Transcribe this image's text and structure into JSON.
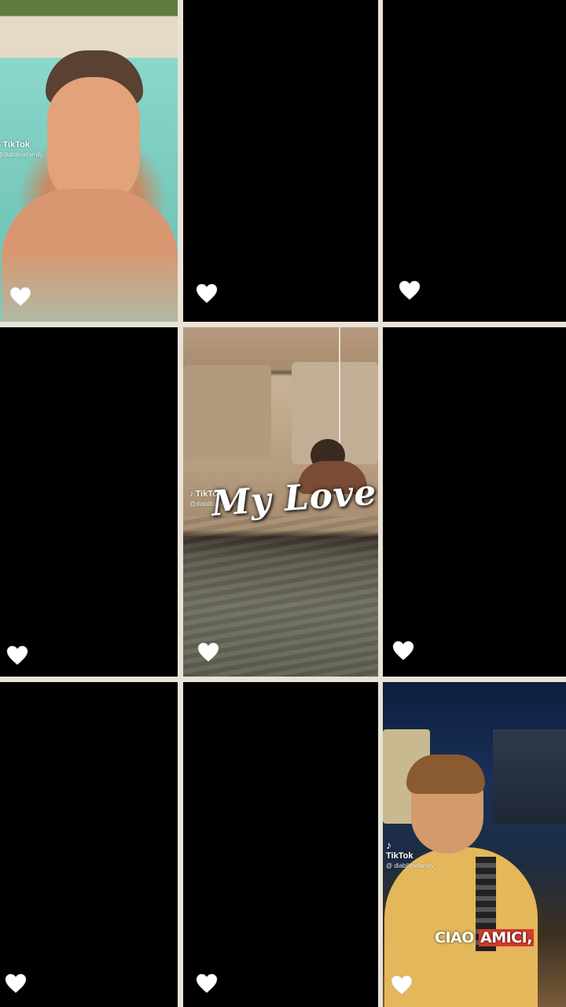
{
  "grid": {
    "tiles": [
      {
        "id": "tile-1",
        "type": "video",
        "watermark": {
          "brand": "TikTok",
          "handle": "@diablitoefamily"
        }
      },
      {
        "id": "tile-2",
        "type": "blank"
      },
      {
        "id": "tile-3",
        "type": "blank"
      },
      {
        "id": "tile-4",
        "type": "blank"
      },
      {
        "id": "tile-5",
        "type": "video",
        "overlay_text": "My Love",
        "watermark": {
          "brand": "TikTok",
          "handle": "@diablitoefamily"
        }
      },
      {
        "id": "tile-6",
        "type": "blank"
      },
      {
        "id": "tile-7",
        "type": "blank"
      },
      {
        "id": "tile-8",
        "type": "blank"
      },
      {
        "id": "tile-9",
        "type": "video",
        "caption_word1": "CIAO",
        "caption_word2": "AMICI,",
        "watermark": {
          "brand": "TikTok",
          "handle": "@ diablitoefamily"
        }
      }
    ],
    "like_icon": "heart-icon",
    "colors": {
      "background": "#e9e2d6",
      "tile_blank": "#000000",
      "heart": "#ffffff",
      "caption_highlight": "#d33b2c"
    }
  }
}
